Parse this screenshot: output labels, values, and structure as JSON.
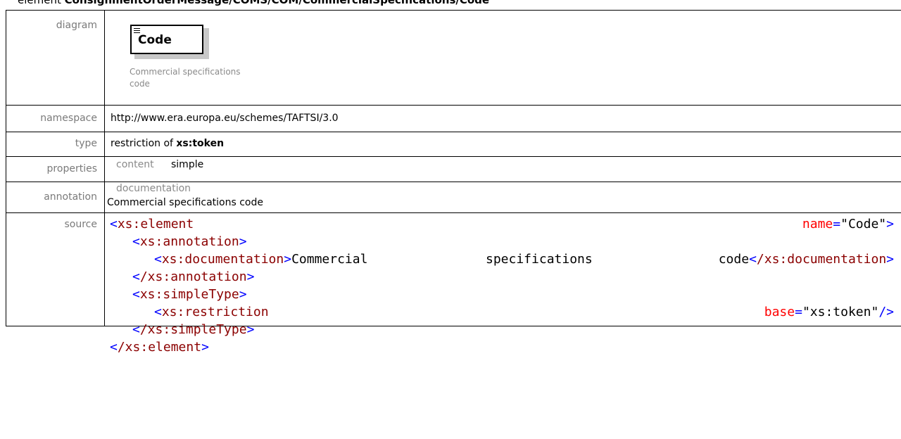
{
  "element_title": {
    "prefix": "element",
    "path": "ConsignmentOrderMessage/COMS/COM/CommercialSpecifications/Code"
  },
  "diagram": {
    "label": "diagram",
    "element_name": "Code",
    "caption": "Commercial specifications code"
  },
  "namespace": {
    "label": "namespace",
    "value": "http://www.era.europa.eu/schemes/TAFTSI/3.0"
  },
  "type": {
    "label": "type",
    "prefix": "restriction of",
    "base": "xs:token"
  },
  "properties": {
    "label": "properties",
    "key": "content",
    "value": "simple"
  },
  "annotation": {
    "label": "annotation",
    "key": "documentation",
    "value": "Commercial specifications code"
  },
  "source": {
    "label": "source",
    "l1_tag": "xs:element",
    "l1_attr": "name",
    "l1_val": "\"Code\"",
    "l2_tag": "xs:annotation",
    "l3_tag": "xs:documentation",
    "l3_word1": "Commercial",
    "l3_word2": "specifications",
    "l3_word3": "code",
    "l3_close": "/xs:documentation",
    "l4_tag": "/xs:annotation",
    "l5_tag": "xs:simpleType",
    "l6_tag": "xs:restriction",
    "l6_attr": "base",
    "l6_val": "\"xs:token\"",
    "l7_tag": "/xs:simpleType",
    "l8_tag": "/xs:element"
  },
  "colors": {
    "tag": "#8b0000",
    "attr": "#ff0000",
    "punct": "#0000ff",
    "label": "#7a7a7a"
  }
}
